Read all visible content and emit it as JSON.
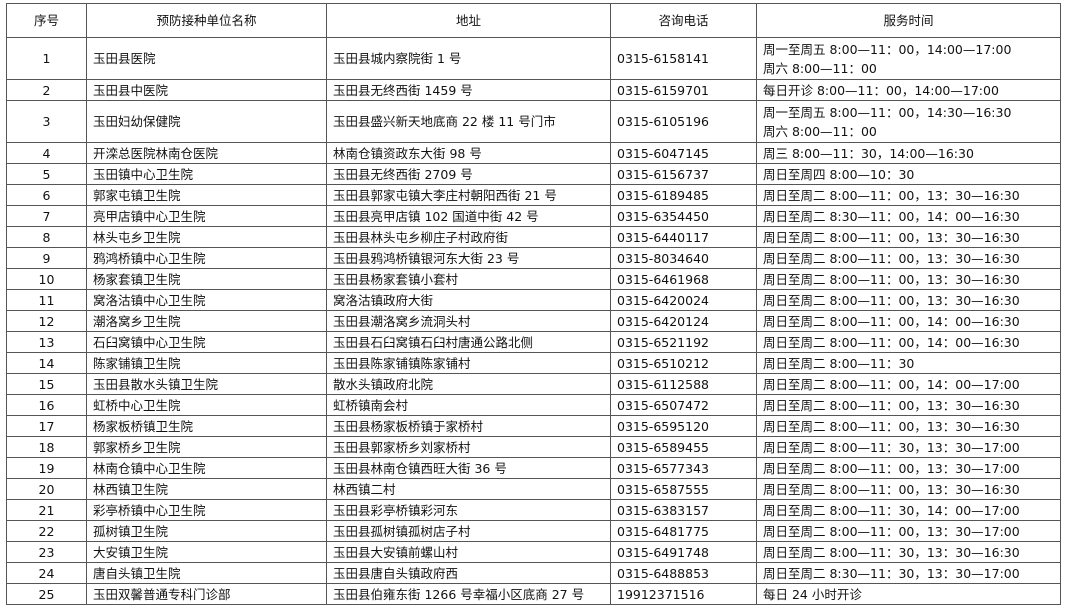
{
  "headers": [
    "序号",
    "预防接种单位名称",
    "地址",
    "咨询电话",
    "服务时间"
  ],
  "rows": [
    {
      "no": "1",
      "name": "玉田县医院",
      "address": "玉田县城内察院街 1 号",
      "phone": "0315-6158141",
      "hours": [
        "周一至周五 8:00—11：00，14:00—17:00",
        "周六 8:00—11：00"
      ]
    },
    {
      "no": "2",
      "name": "玉田县中医院",
      "address": "玉田县无终西街 1459 号",
      "phone": "0315-6159701",
      "hours": [
        "每日开诊 8:00—11：00，14:00—17:00"
      ]
    },
    {
      "no": "3",
      "name": "玉田妇幼保健院",
      "address": "玉田县盛兴新天地底商 22 楼 11 号门市",
      "phone": "0315-6105196",
      "hours": [
        "周一至周五 8:00—11：00，14:30—16:30",
        "周六 8:00—11：00"
      ]
    },
    {
      "no": "4",
      "name": "开滦总医院林南仓医院",
      "address": "林南仓镇资政东大街 98 号",
      "phone": "0315-6047145",
      "hours": [
        "周三 8:00—11：30，14:00—16:30"
      ]
    },
    {
      "no": "5",
      "name": "玉田镇中心卫生院",
      "address": "玉田县无终西街 2709 号",
      "phone": "0315-6156737",
      "hours": [
        "周日至周四 8:00—10：30"
      ]
    },
    {
      "no": "6",
      "name": "郭家屯镇卫生院",
      "address": "玉田县郭家屯镇大李庄村朝阳西街 21 号",
      "phone": "0315-6189485",
      "hours": [
        "周日至周二 8:00—11：00，13：30—16:30"
      ]
    },
    {
      "no": "7",
      "name": "亮甲店镇中心卫生院",
      "address": "玉田县亮甲店镇 102 国道中街 42 号",
      "phone": "0315-6354450",
      "hours": [
        "周日至周二 8:30—11：00，14：00—16:30"
      ]
    },
    {
      "no": "8",
      "name": "林头屯乡卫生院",
      "address": "玉田县林头屯乡柳庄子村政府街",
      "phone": "0315-6440117",
      "hours": [
        "周日至周二 8:00—11：00，13：30—16:30"
      ]
    },
    {
      "no": "9",
      "name": "鸦鸿桥镇中心卫生院",
      "address": "玉田县鸦鸿桥镇银河东大街 23 号",
      "phone": "0315-8034640",
      "hours": [
        "周日至周二 8:00—11：00，13：30—16:30"
      ]
    },
    {
      "no": "10",
      "name": "杨家套镇卫生院",
      "address": "玉田县杨家套镇小套村",
      "phone": "0315-6461968",
      "hours": [
        "周日至周二 8:00—11：00，13：30—16:30"
      ]
    },
    {
      "no": "11",
      "name": "窝洛沽镇中心卫生院",
      "address": "窝洛沽镇政府大街",
      "phone": "0315-6420024",
      "hours": [
        "周日至周二 8:00—11：00，13：30—16:30"
      ]
    },
    {
      "no": "12",
      "name": "潮洛窝乡卫生院",
      "address": "玉田县潮洛窝乡流洞头村",
      "phone": "0315-6420124",
      "hours": [
        "周日至周二 8:00—11：00，14：00—16:30"
      ]
    },
    {
      "no": "13",
      "name": "石臼窝镇中心卫生院",
      "address": "玉田县石臼窝镇石臼村唐通公路北侧",
      "phone": "0315-6521192",
      "hours": [
        "周日至周二 8:00—11：00，14：00—16:30"
      ]
    },
    {
      "no": "14",
      "name": "陈家铺镇卫生院",
      "address": "玉田县陈家铺镇陈家铺村",
      "phone": "0315-6510212",
      "hours": [
        "周日至周二 8:00—11：30"
      ]
    },
    {
      "no": "15",
      "name": "玉田县散水头镇卫生院",
      "address": "散水头镇政府北院",
      "phone": "0315-6112588",
      "hours": [
        "周日至周二 8:00—11：00，14：00—17:00"
      ]
    },
    {
      "no": "16",
      "name": "虹桥中心卫生院",
      "address": "虹桥镇南会村",
      "phone": "0315-6507472",
      "hours": [
        "周日至周二 8:00—11：00，13：30—16:30"
      ]
    },
    {
      "no": "17",
      "name": "杨家板桥镇卫生院",
      "address": "玉田县杨家板桥镇于家桥村",
      "phone": "0315-6595120",
      "hours": [
        "周日至周二 8:00—11：00，13：30—16:30"
      ]
    },
    {
      "no": "18",
      "name": "郭家桥乡卫生院",
      "address": "玉田县郭家桥乡刘家桥村",
      "phone": "0315-6589455",
      "hours": [
        "周日至周二 8:00—11：30，13：30—17:00"
      ]
    },
    {
      "no": "19",
      "name": "林南仓镇中心卫生院",
      "address": "玉田县林南仓镇西旺大街 36 号",
      "phone": "0315-6577343",
      "hours": [
        "周日至周二 8:00—11：00，13：30—17:00"
      ]
    },
    {
      "no": "20",
      "name": "林西镇卫生院",
      "address": "林西镇二村",
      "phone": "0315-6587555",
      "hours": [
        "周日至周二 8:00—11：00，13：30—16:30"
      ]
    },
    {
      "no": "21",
      "name": "彩亭桥镇中心卫生院",
      "address": "玉田县彩亭桥镇彩河东",
      "phone": "0315-6383157",
      "hours": [
        "周日至周二 8:00—11：30，14：00—17:00"
      ]
    },
    {
      "no": "22",
      "name": "孤树镇卫生院",
      "address": "玉田县孤树镇孤树店子村",
      "phone": "0315-6481775",
      "hours": [
        "周日至周二 8:00—11：00，13：30—17:00"
      ]
    },
    {
      "no": "23",
      "name": "大安镇卫生院",
      "address": "玉田县大安镇前螺山村",
      "phone": "0315-6491748",
      "hours": [
        "周日至周二 8:00—11：30，13：30—16:30"
      ]
    },
    {
      "no": "24",
      "name": "唐自头镇卫生院",
      "address": "玉田县唐自头镇政府西",
      "phone": "0315-6488853",
      "hours": [
        "周日至周二 8:30—11：30，13：30—17:00"
      ]
    },
    {
      "no": "25",
      "name": "玉田双馨普通专科门诊部",
      "address": "玉田县伯雍东街 1266 号幸福小区底商 27 号",
      "phone": "19912371516",
      "hours": [
        "每日 24 小时开诊"
      ]
    }
  ]
}
